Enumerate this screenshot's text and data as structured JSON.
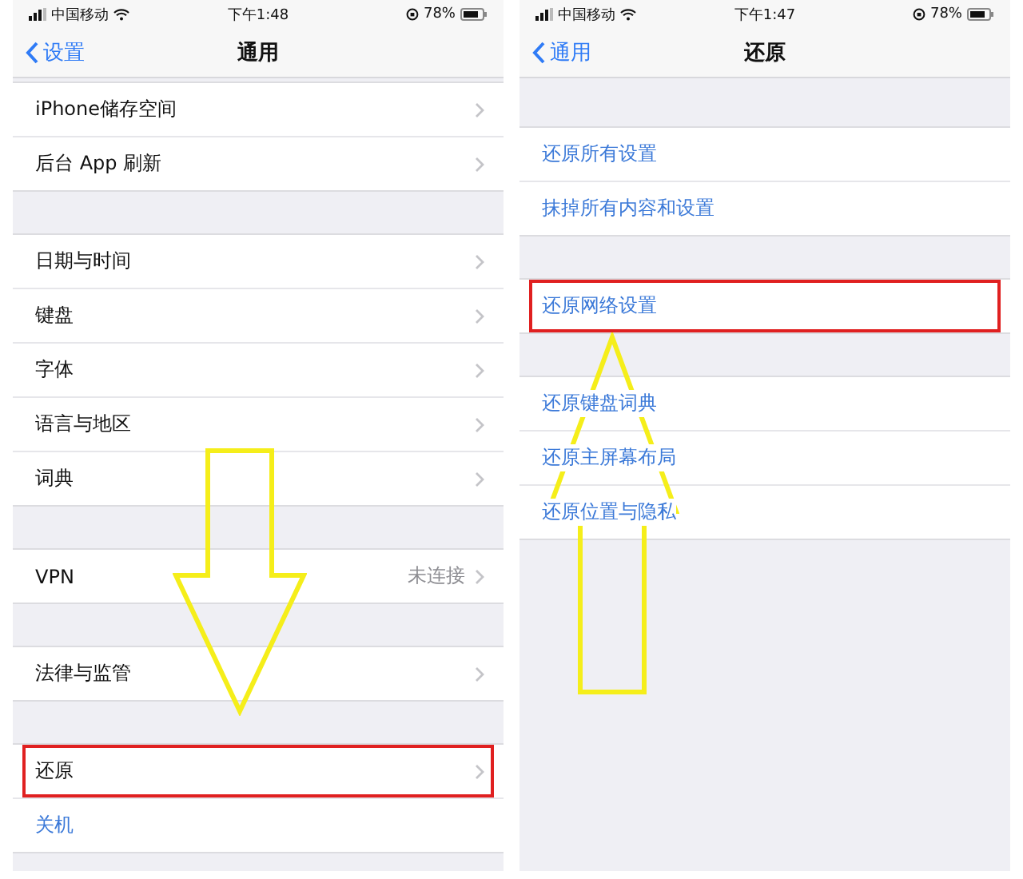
{
  "screens": [
    {
      "status_bar": {
        "carrier": "中国移动",
        "time": "下午1:48",
        "battery": "78%"
      },
      "nav": {
        "back": "设置",
        "title": "通用"
      },
      "sections": [
        {
          "rows": [
            {
              "label": "iPhone储存空间",
              "kind": "nav",
              "highlighted": false
            },
            {
              "label": "后台 App 刷新",
              "kind": "nav",
              "highlighted": false
            }
          ]
        },
        {
          "rows": [
            {
              "label": "日期与时间",
              "kind": "nav",
              "highlighted": false
            },
            {
              "label": "键盘",
              "kind": "nav",
              "highlighted": false
            },
            {
              "label": "字体",
              "kind": "nav",
              "highlighted": false
            },
            {
              "label": "语言与地区",
              "kind": "nav",
              "highlighted": false
            },
            {
              "label": "词典",
              "kind": "nav",
              "highlighted": false
            }
          ]
        },
        {
          "rows": [
            {
              "label": "VPN",
              "value": "未连接",
              "kind": "nav",
              "highlighted": false
            }
          ]
        },
        {
          "rows": [
            {
              "label": "法律与监管",
              "kind": "nav",
              "highlighted": false
            }
          ]
        },
        {
          "rows": [
            {
              "label": "还原",
              "kind": "nav",
              "highlighted": true
            },
            {
              "label": "关机",
              "kind": "action",
              "highlighted": false
            }
          ]
        }
      ]
    },
    {
      "status_bar": {
        "carrier": "中国移动",
        "time": "下午1:47",
        "battery": "78%"
      },
      "nav": {
        "back": "通用",
        "title": "还原"
      },
      "sections": [
        {
          "rows": [
            {
              "label": "还原所有设置",
              "kind": "action",
              "highlighted": false
            },
            {
              "label": "抹掉所有内容和设置",
              "kind": "action",
              "highlighted": false
            }
          ]
        },
        {
          "rows": [
            {
              "label": "还原网络设置",
              "kind": "action",
              "highlighted": true
            }
          ]
        },
        {
          "rows": [
            {
              "label": "还原键盘词典",
              "kind": "action",
              "highlighted": false
            },
            {
              "label": "还原主屏幕布局",
              "kind": "action",
              "highlighted": false
            },
            {
              "label": "还原位置与隐私",
              "kind": "action",
              "highlighted": false
            }
          ]
        }
      ]
    }
  ]
}
